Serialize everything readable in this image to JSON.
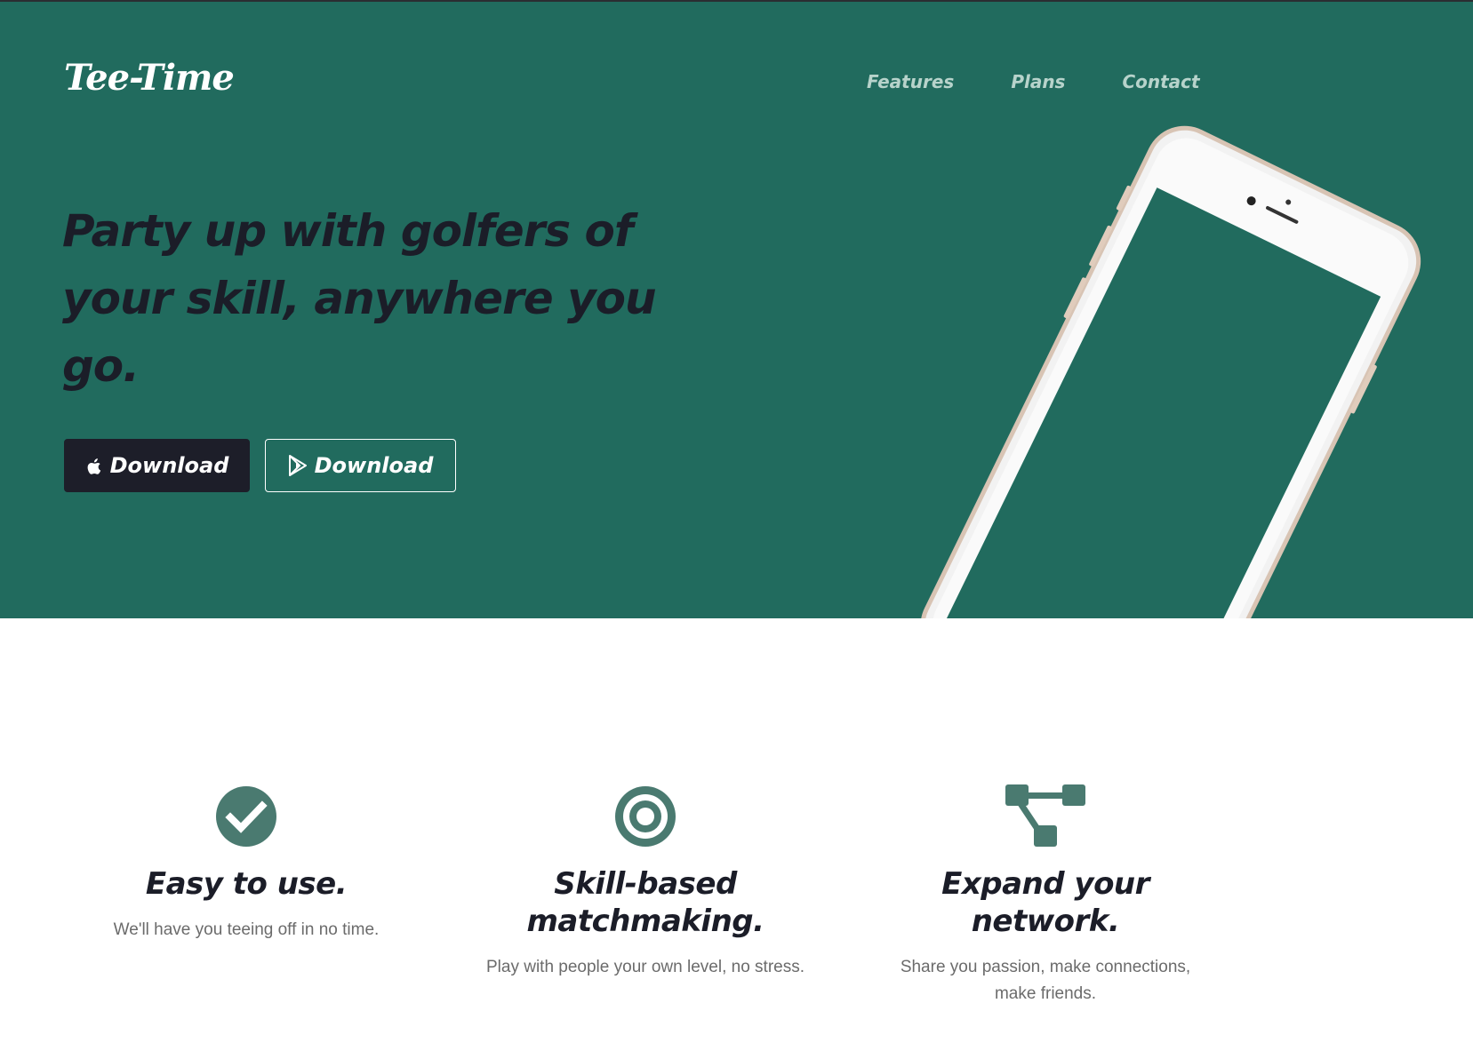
{
  "brand": {
    "name": "Tee-Time"
  },
  "nav": {
    "items": [
      {
        "label": "Features"
      },
      {
        "label": "Plans"
      },
      {
        "label": "Contact"
      }
    ]
  },
  "hero": {
    "headline": "Party up with golfers of your skill, anywhere you go.",
    "buttons": {
      "ios_label": "Download",
      "android_label": "Download"
    }
  },
  "features": [
    {
      "icon": "check-circle-icon",
      "title": "Easy to use.",
      "text": "We'll have you teeing off in no time."
    },
    {
      "icon": "bullseye-icon",
      "title": "Skill-based matchmaking.",
      "text": "Play with people your own level, no stress."
    },
    {
      "icon": "sitemap-icon",
      "title": "Expand your network.",
      "text": "Share you passion, make connections, make friends."
    }
  ],
  "colors": {
    "hero_bg": "#216b5e",
    "headline": "#1b1d28",
    "nav_link": "#b7d3cb",
    "icon": "#4a7a70",
    "body_text": "#6b6b6b"
  }
}
